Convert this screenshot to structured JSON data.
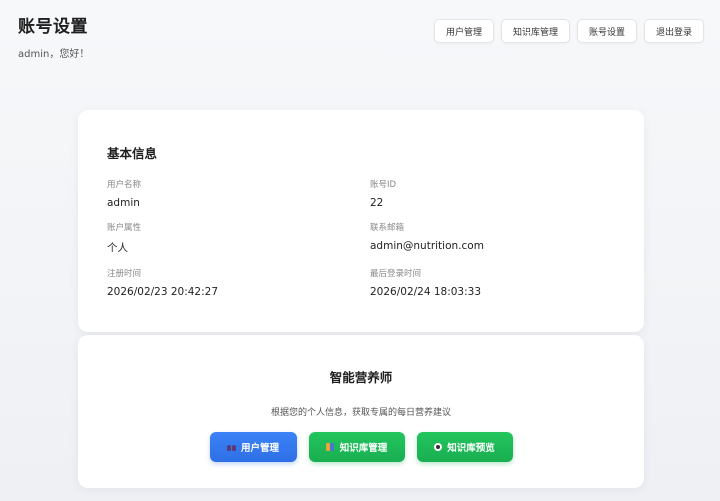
{
  "header": {
    "title": "账号设置",
    "greeting": "admin，您好！"
  },
  "nav": {
    "user_management": "用户管理",
    "kb_management": "知识库管理",
    "account_settings": "账号设置",
    "logout": "退出登录"
  },
  "basic_info": {
    "title": "基本信息",
    "fields": [
      {
        "label": "用户名称",
        "value": "admin"
      },
      {
        "label": "账号ID",
        "value": "22"
      },
      {
        "label": "账户属性",
        "value": "个人"
      },
      {
        "label": "联系邮箱",
        "value": "admin@nutrition.com"
      },
      {
        "label": "注册时间",
        "value": "2026/02/23 20:42:27"
      },
      {
        "label": "最后登录时间",
        "value": "2026/02/24 18:03:33"
      }
    ]
  },
  "ai": {
    "title": "智能营养师",
    "description": "根据您的个人信息，获取专属的每日营养建议",
    "buttons": {
      "user_management": "用户管理",
      "kb_management": "知识库管理",
      "kb_preview": "知识库预览"
    }
  },
  "colors": {
    "primary_blue": "#3c82f6",
    "primary_green": "#22c55e"
  },
  "icons": {
    "user_management": "users-icon",
    "kb_management": "books-icon",
    "kb_preview": "eye-icon"
  }
}
